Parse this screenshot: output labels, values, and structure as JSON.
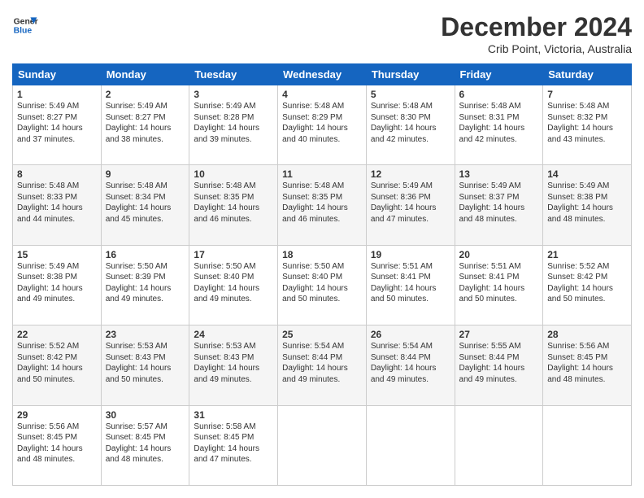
{
  "logo": {
    "line1": "General",
    "line2": "Blue"
  },
  "title": "December 2024",
  "subtitle": "Crib Point, Victoria, Australia",
  "header_days": [
    "Sunday",
    "Monday",
    "Tuesday",
    "Wednesday",
    "Thursday",
    "Friday",
    "Saturday"
  ],
  "weeks": [
    [
      {
        "day": "1",
        "sunrise": "5:49 AM",
        "sunset": "8:27 PM",
        "daylight": "14 hours and 37 minutes."
      },
      {
        "day": "2",
        "sunrise": "5:49 AM",
        "sunset": "8:27 PM",
        "daylight": "14 hours and 38 minutes."
      },
      {
        "day": "3",
        "sunrise": "5:49 AM",
        "sunset": "8:28 PM",
        "daylight": "14 hours and 39 minutes."
      },
      {
        "day": "4",
        "sunrise": "5:48 AM",
        "sunset": "8:29 PM",
        "daylight": "14 hours and 40 minutes."
      },
      {
        "day": "5",
        "sunrise": "5:48 AM",
        "sunset": "8:30 PM",
        "daylight": "14 hours and 42 minutes."
      },
      {
        "day": "6",
        "sunrise": "5:48 AM",
        "sunset": "8:31 PM",
        "daylight": "14 hours and 42 minutes."
      },
      {
        "day": "7",
        "sunrise": "5:48 AM",
        "sunset": "8:32 PM",
        "daylight": "14 hours and 43 minutes."
      }
    ],
    [
      {
        "day": "8",
        "sunrise": "5:48 AM",
        "sunset": "8:33 PM",
        "daylight": "14 hours and 44 minutes."
      },
      {
        "day": "9",
        "sunrise": "5:48 AM",
        "sunset": "8:34 PM",
        "daylight": "14 hours and 45 minutes."
      },
      {
        "day": "10",
        "sunrise": "5:48 AM",
        "sunset": "8:35 PM",
        "daylight": "14 hours and 46 minutes."
      },
      {
        "day": "11",
        "sunrise": "5:48 AM",
        "sunset": "8:35 PM",
        "daylight": "14 hours and 46 minutes."
      },
      {
        "day": "12",
        "sunrise": "5:49 AM",
        "sunset": "8:36 PM",
        "daylight": "14 hours and 47 minutes."
      },
      {
        "day": "13",
        "sunrise": "5:49 AM",
        "sunset": "8:37 PM",
        "daylight": "14 hours and 48 minutes."
      },
      {
        "day": "14",
        "sunrise": "5:49 AM",
        "sunset": "8:38 PM",
        "daylight": "14 hours and 48 minutes."
      }
    ],
    [
      {
        "day": "15",
        "sunrise": "5:49 AM",
        "sunset": "8:38 PM",
        "daylight": "14 hours and 49 minutes."
      },
      {
        "day": "16",
        "sunrise": "5:50 AM",
        "sunset": "8:39 PM",
        "daylight": "14 hours and 49 minutes."
      },
      {
        "day": "17",
        "sunrise": "5:50 AM",
        "sunset": "8:40 PM",
        "daylight": "14 hours and 49 minutes."
      },
      {
        "day": "18",
        "sunrise": "5:50 AM",
        "sunset": "8:40 PM",
        "daylight": "14 hours and 50 minutes."
      },
      {
        "day": "19",
        "sunrise": "5:51 AM",
        "sunset": "8:41 PM",
        "daylight": "14 hours and 50 minutes."
      },
      {
        "day": "20",
        "sunrise": "5:51 AM",
        "sunset": "8:41 PM",
        "daylight": "14 hours and 50 minutes."
      },
      {
        "day": "21",
        "sunrise": "5:52 AM",
        "sunset": "8:42 PM",
        "daylight": "14 hours and 50 minutes."
      }
    ],
    [
      {
        "day": "22",
        "sunrise": "5:52 AM",
        "sunset": "8:42 PM",
        "daylight": "14 hours and 50 minutes."
      },
      {
        "day": "23",
        "sunrise": "5:53 AM",
        "sunset": "8:43 PM",
        "daylight": "14 hours and 50 minutes."
      },
      {
        "day": "24",
        "sunrise": "5:53 AM",
        "sunset": "8:43 PM",
        "daylight": "14 hours and 49 minutes."
      },
      {
        "day": "25",
        "sunrise": "5:54 AM",
        "sunset": "8:44 PM",
        "daylight": "14 hours and 49 minutes."
      },
      {
        "day": "26",
        "sunrise": "5:54 AM",
        "sunset": "8:44 PM",
        "daylight": "14 hours and 49 minutes."
      },
      {
        "day": "27",
        "sunrise": "5:55 AM",
        "sunset": "8:44 PM",
        "daylight": "14 hours and 49 minutes."
      },
      {
        "day": "28",
        "sunrise": "5:56 AM",
        "sunset": "8:45 PM",
        "daylight": "14 hours and 48 minutes."
      }
    ],
    [
      {
        "day": "29",
        "sunrise": "5:56 AM",
        "sunset": "8:45 PM",
        "daylight": "14 hours and 48 minutes."
      },
      {
        "day": "30",
        "sunrise": "5:57 AM",
        "sunset": "8:45 PM",
        "daylight": "14 hours and 48 minutes."
      },
      {
        "day": "31",
        "sunrise": "5:58 AM",
        "sunset": "8:45 PM",
        "daylight": "14 hours and 47 minutes."
      },
      null,
      null,
      null,
      null
    ]
  ]
}
